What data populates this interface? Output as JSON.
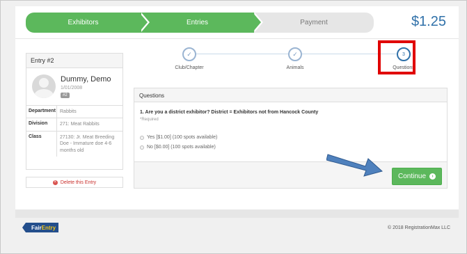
{
  "wizard": {
    "steps": [
      "Exhibitors",
      "Entries",
      "Payment"
    ],
    "total": "$1.25"
  },
  "entry": {
    "title": "Entry #2",
    "name": "Dummy, Demo",
    "dob": "1/01/2008",
    "badge": "#2",
    "fields": [
      {
        "label": "Department",
        "value": "Rabbits"
      },
      {
        "label": "Division",
        "value": "271: Meat Rabbits"
      },
      {
        "label": "Class",
        "value": "27130: Jr. Meat Breeding Doe - Immature doe 4-6 months old"
      }
    ],
    "delete_label": "Delete this Entry"
  },
  "progress": {
    "steps": [
      {
        "label": "Club/Chapter",
        "icon": "check-icon",
        "glyph": "✓"
      },
      {
        "label": "Animals",
        "icon": "check-icon",
        "glyph": "✓"
      },
      {
        "label": "Questions",
        "icon": "step-number",
        "glyph": "3"
      }
    ]
  },
  "questions": {
    "panel_title": "Questions",
    "question": "1. Are you a district exhibitor? District = Exhibitors not from Hancock County",
    "required": "*Required",
    "options": [
      "Yes [$1.00] (100 spots available)",
      "No [$0.00] (100 spots available)"
    ],
    "continue_label": "Continue"
  },
  "footer": {
    "logo_part1": "Fair",
    "logo_part2": "Entry",
    "copyright": "© 2018 RegistrationMax LLC"
  },
  "colors": {
    "green": "#5cb85c",
    "blue": "#3071a9",
    "highlight_red": "#e00000",
    "arrow_blue": "#4f81bd"
  }
}
